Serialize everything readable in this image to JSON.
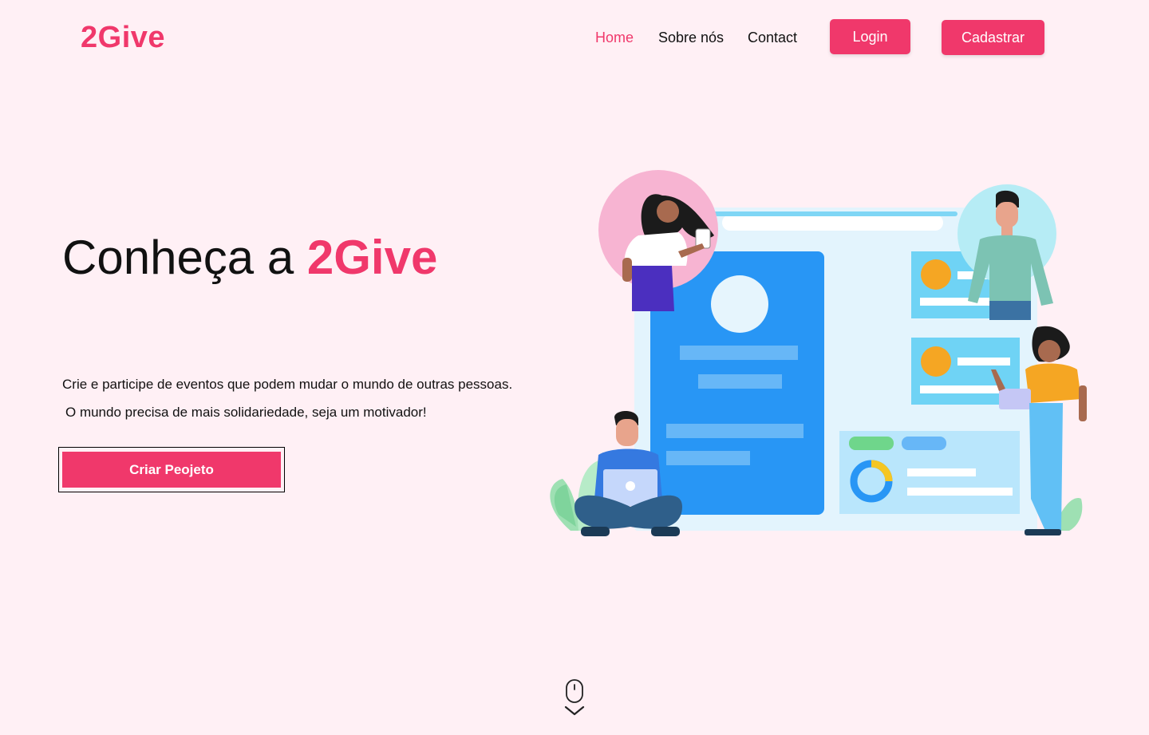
{
  "header": {
    "logo": "2Give",
    "nav": [
      {
        "label": "Home",
        "active": true
      },
      {
        "label": "Sobre nós",
        "active": false
      },
      {
        "label": "Contact",
        "active": false
      }
    ],
    "login_label": "Login",
    "signup_label": "Cadastrar"
  },
  "hero": {
    "title_prefix": "Conheça a",
    "title_brand": "2Give",
    "line1": "Crie e participe de eventos que podem mudar o mundo de outras pessoas.",
    "line2": "O mundo precisa de mais solidariedade, seja um motivador!",
    "cta_label": "Criar Peojeto"
  },
  "icons": {
    "scroll": "mouse-scroll-icon"
  },
  "colors": {
    "brand": "#f0386b",
    "background": "#fff0f5"
  }
}
